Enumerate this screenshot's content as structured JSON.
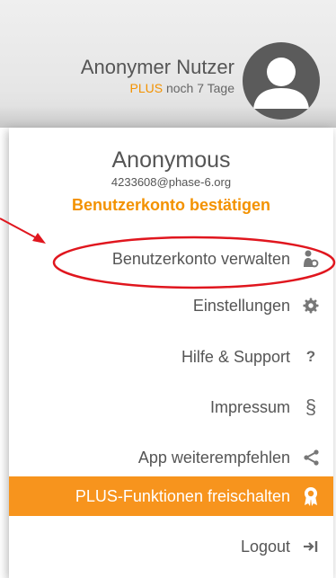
{
  "header": {
    "user_name": "Anonymer Nutzer",
    "plus_label": "PLUS",
    "plus_remaining": "noch 7 Tage"
  },
  "account": {
    "name": "Anonymous",
    "email": "4233608@phase-6.org",
    "confirm_label": "Benutzerkonto bestätigen"
  },
  "menu": {
    "items": [
      {
        "label": "Benutzerkonto verwalten",
        "icon": "user-settings-icon"
      },
      {
        "label": "Einstellungen",
        "icon": "gear-icon"
      },
      {
        "label": "Hilfe & Support",
        "icon": "question-icon"
      },
      {
        "label": "Impressum",
        "icon": "section-icon"
      },
      {
        "label": "App weiterempfehlen",
        "icon": "share-icon"
      },
      {
        "label": "PLUS-Funktionen freischalten",
        "icon": "award-icon",
        "highlight": true
      },
      {
        "label": "Logout",
        "icon": "logout-icon"
      }
    ]
  },
  "colors": {
    "accent": "#f39200",
    "highlight_bg": "#f7941d",
    "annotation": "#e0161e"
  }
}
